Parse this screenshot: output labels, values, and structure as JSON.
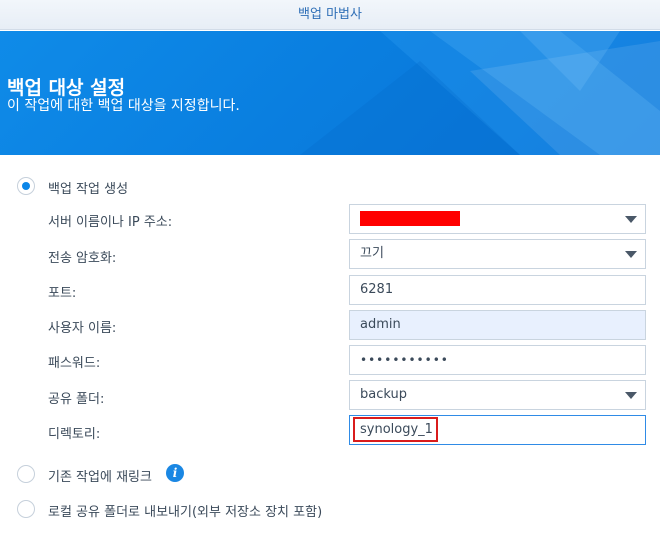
{
  "window": {
    "title": "백업 마법사"
  },
  "header": {
    "title": "백업 대상 설정",
    "subtitle": "이 작업에 대한 백업 대상을 지정합니다."
  },
  "options": {
    "create": {
      "label": "백업 작업 생성",
      "selected": true
    },
    "relink": {
      "label": "기존 작업에 재링크",
      "selected": false,
      "info_icon": "info-icon"
    },
    "export": {
      "label": "로컬 공유 폴더로 내보내기(외부 저장소 장치 포함)",
      "selected": false
    }
  },
  "form": {
    "server": {
      "label": "서버 이름이나 IP 주소:",
      "value": "",
      "redacted": true
    },
    "encryption": {
      "label": "전송 암호화:",
      "value": "끄기"
    },
    "port": {
      "label": "포트:",
      "value": "6281"
    },
    "username": {
      "label": "사용자 이름:",
      "value": "admin"
    },
    "password": {
      "label": "패스워드:",
      "value": "•••••••••••"
    },
    "shared_folder": {
      "label": "공유 폴더:",
      "value": "backup"
    },
    "directory": {
      "label": "디렉토리:",
      "value": "synology_1"
    }
  },
  "colors": {
    "banner": "#0a7fe0",
    "accent": "#0b86e8",
    "highlight": "#d91c1c",
    "redaction": "#ff0000",
    "title_text": "#2f6fb7"
  }
}
